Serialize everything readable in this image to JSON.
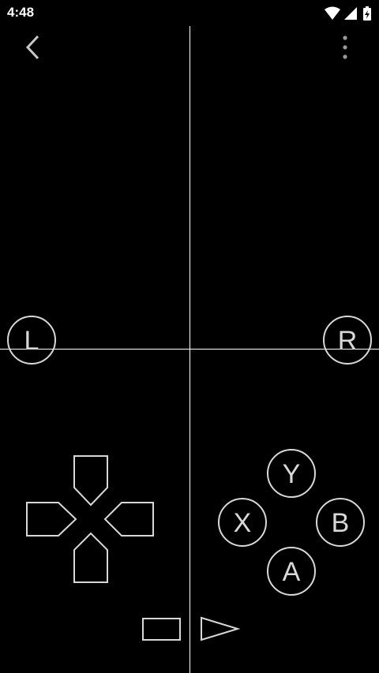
{
  "status_bar": {
    "time": "4:48",
    "icons": [
      "wifi-icon",
      "cell-signal-icon",
      "battery-charging-icon"
    ]
  },
  "toolbar": {
    "back_icon": "chevron-left-icon",
    "menu_icon": "more-vertical-icon"
  },
  "controller": {
    "shoulder_left": "L",
    "shoulder_right": "R",
    "face_y": "Y",
    "face_x": "X",
    "face_b": "B",
    "face_a": "A",
    "dpad_icons": [
      "dpad-up-icon",
      "dpad-left-icon",
      "dpad-right-icon",
      "dpad-down-icon"
    ],
    "select_icon": "select-button-icon",
    "start_icon": "start-play-icon"
  },
  "colors": {
    "background": "#000000",
    "outline": "#d8d8d8",
    "guide_lines": "#ffffff"
  }
}
